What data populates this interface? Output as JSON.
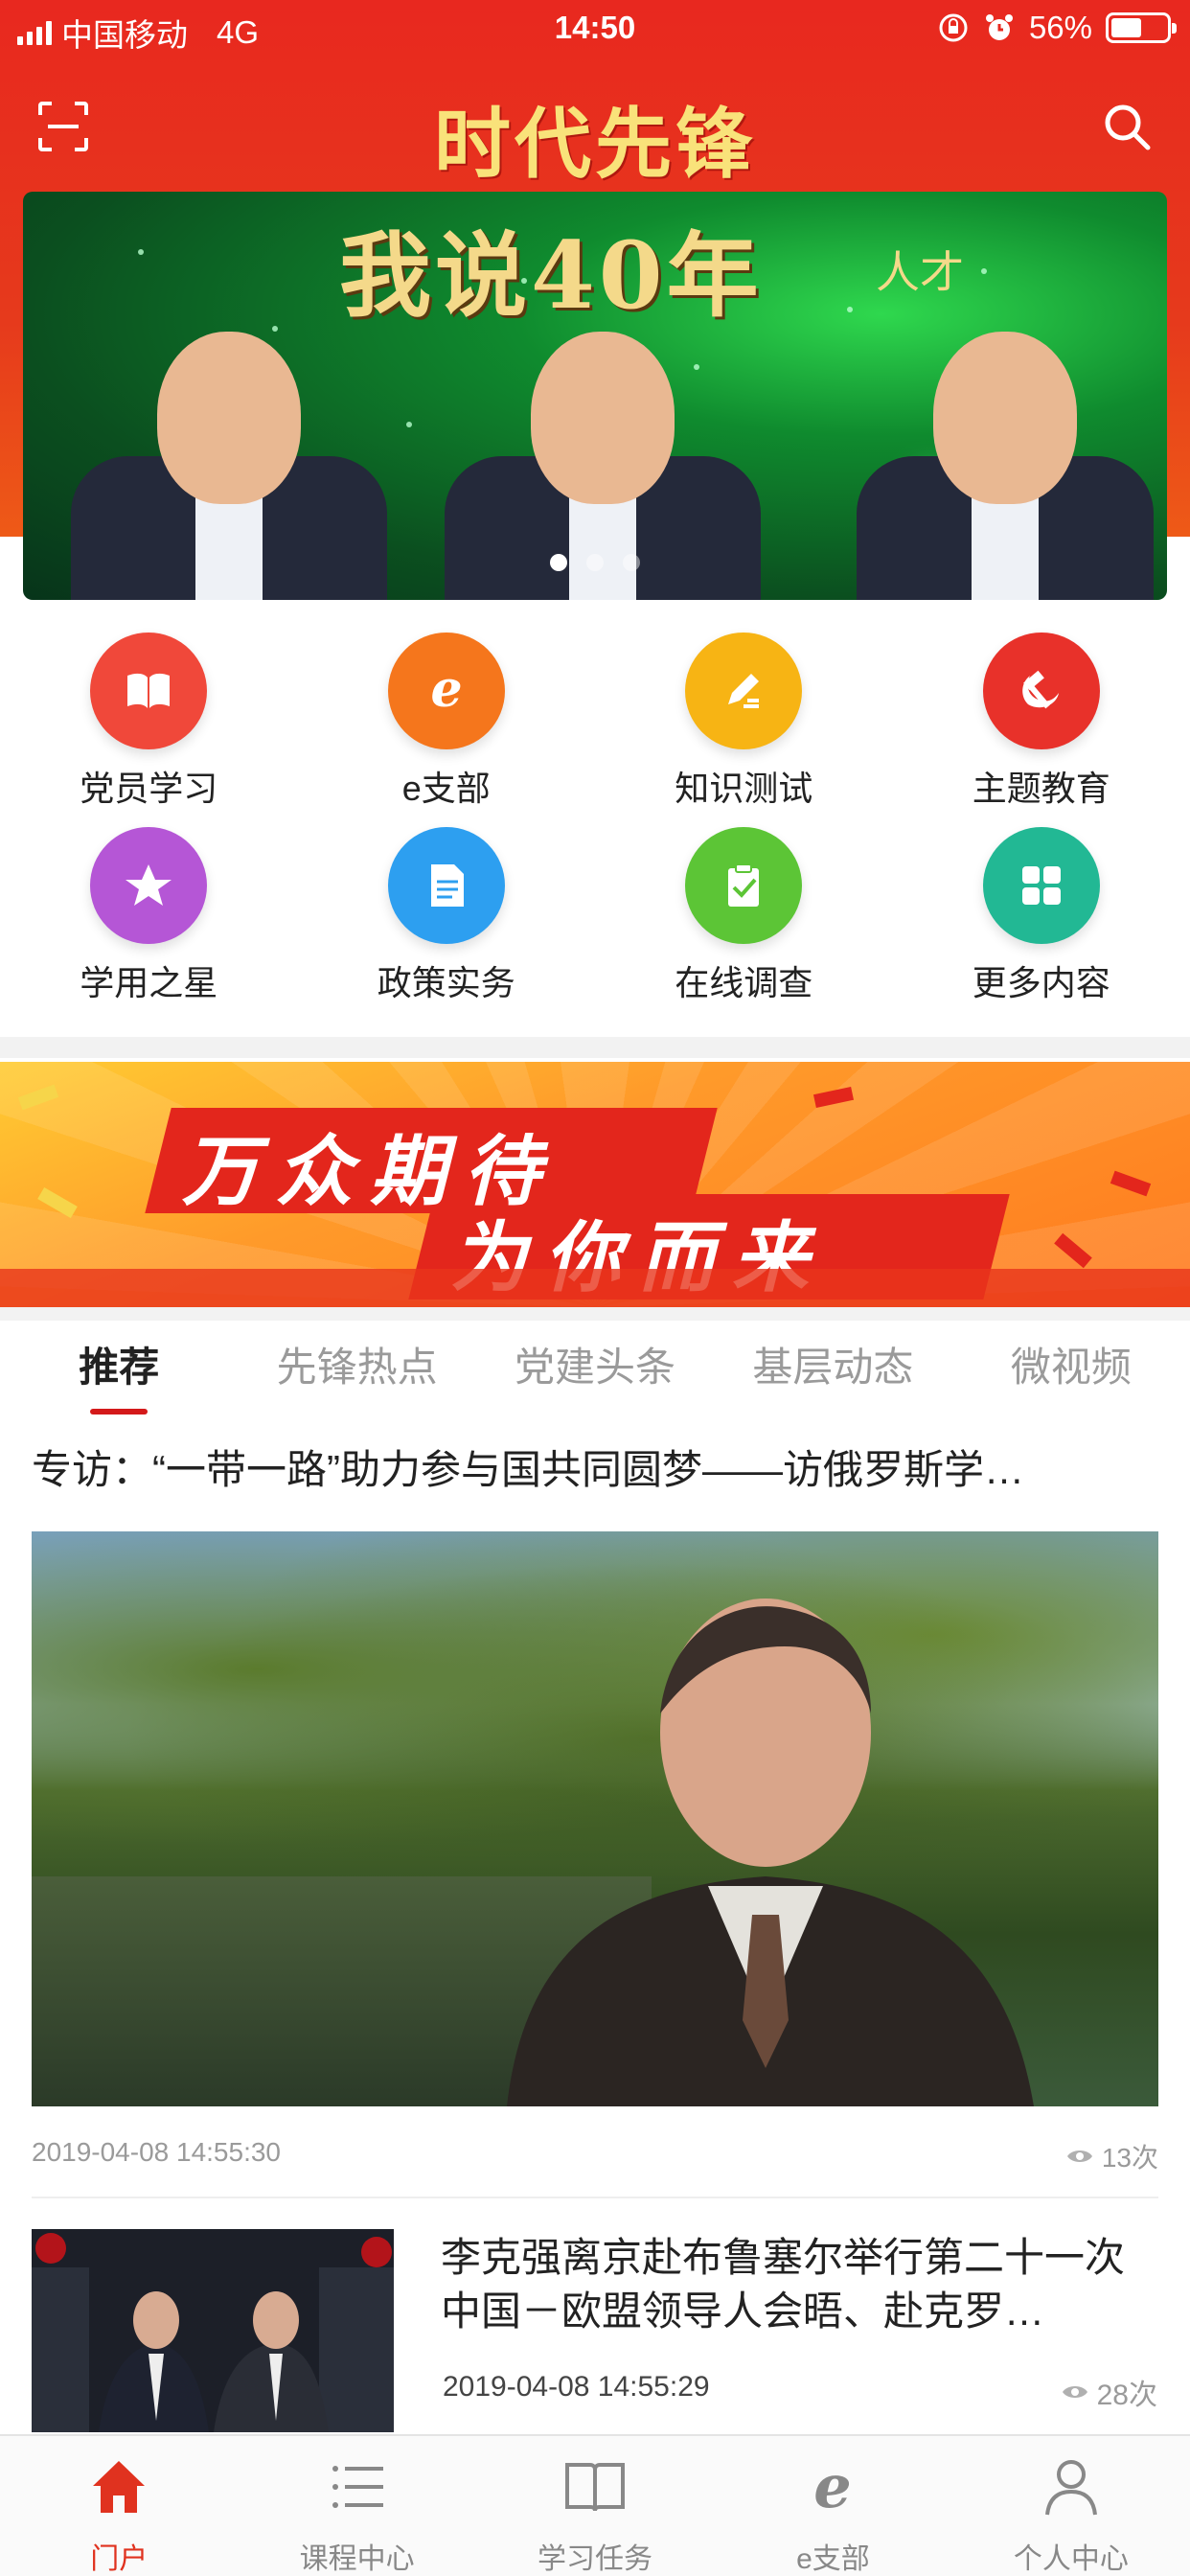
{
  "status_bar": {
    "carrier": "中国移动",
    "network": "4G",
    "time": "14:50",
    "battery": "56%",
    "battery_level": 0.56
  },
  "header": {
    "title": "时代先锋",
    "scan_icon": "scan-icon",
    "search_icon": "search-icon"
  },
  "banner": {
    "headline": "我说40年",
    "subtitle": "人才",
    "slide_count": 3,
    "active_slide": 1
  },
  "grid": {
    "items": [
      {
        "label": "党员学习",
        "icon": "book-icon",
        "color": "#f0483a"
      },
      {
        "label": "e支部",
        "icon": "e-letter-icon",
        "color": "#f5761c"
      },
      {
        "label": "知识测试",
        "icon": "pencil-icon",
        "color": "#f7b414"
      },
      {
        "label": "主题教育",
        "icon": "hammer-sickle-icon",
        "color": "#e8312a"
      },
      {
        "label": "学用之星",
        "icon": "star-icon",
        "color": "#b556d6"
      },
      {
        "label": "政策实务",
        "icon": "document-icon",
        "color": "#2d9ff0"
      },
      {
        "label": "在线调查",
        "icon": "clipboard-check-icon",
        "color": "#5cc536"
      },
      {
        "label": "更多内容",
        "icon": "grid-four-icon",
        "color": "#22b894"
      }
    ]
  },
  "promo": {
    "line1": "万众期待",
    "line2": "为你而来"
  },
  "tabs": {
    "items": [
      "推荐",
      "先锋热点",
      "党建头条",
      "基层动态",
      "微视频"
    ],
    "active": 0
  },
  "feed": {
    "featured": {
      "title": "专访：“一带一路”助力参与国共同圆梦——访俄罗斯学…",
      "timestamp": "2019-04-08 14:55:30",
      "views": "13次"
    },
    "item2": {
      "title": "李克强离京赴布鲁塞尔举行第二十一次中国－欧盟领导人会晤、赴克罗…",
      "timestamp": "2019-04-08 14:55:29",
      "views": "28次"
    }
  },
  "tabbar": {
    "items": [
      {
        "label": "门户",
        "icon": "home-icon"
      },
      {
        "label": "课程中心",
        "icon": "list-icon"
      },
      {
        "label": "学习任务",
        "icon": "open-book-icon"
      },
      {
        "label": "e支部",
        "icon": "e-letter-icon"
      },
      {
        "label": "个人中心",
        "icon": "person-icon"
      }
    ],
    "active": 0,
    "active_color": "#e0321f"
  }
}
